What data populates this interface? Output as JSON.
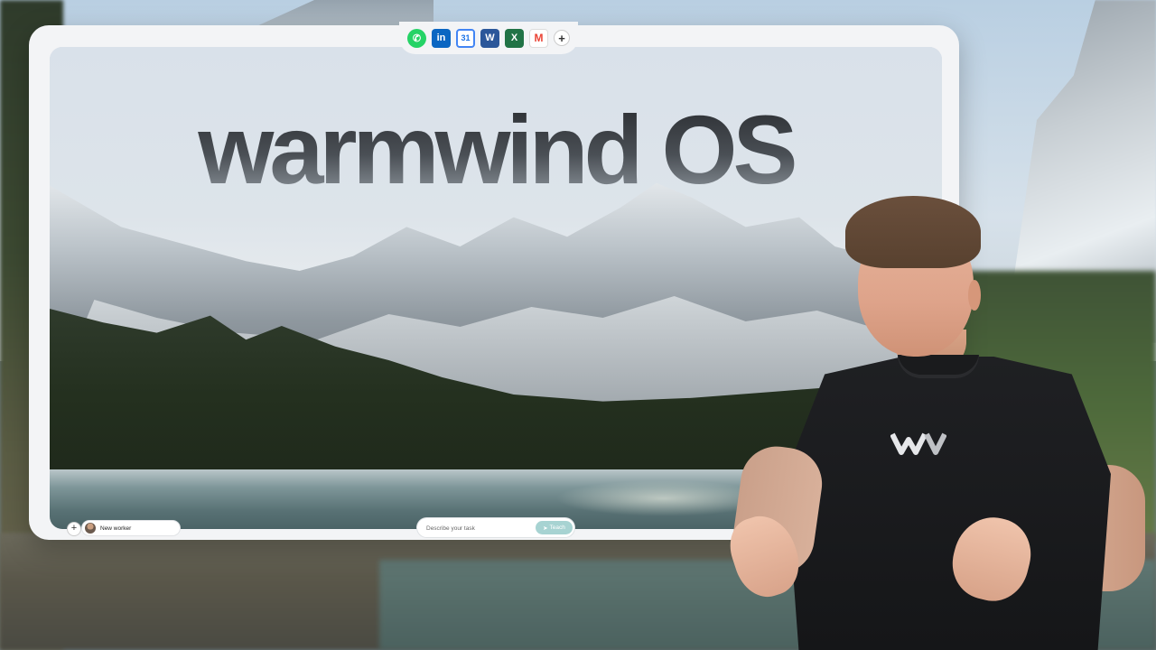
{
  "title": "warmwind OS",
  "dock": {
    "apps": [
      {
        "name": "whatsapp",
        "icon": "whatsapp-icon",
        "glyph": "✆"
      },
      {
        "name": "linkedin",
        "icon": "linkedin-icon",
        "glyph": "in"
      },
      {
        "name": "google-calendar",
        "icon": "calendar-icon",
        "glyph": "31"
      },
      {
        "name": "word",
        "icon": "word-icon",
        "glyph": "W"
      },
      {
        "name": "excel",
        "icon": "excel-icon",
        "glyph": "X"
      },
      {
        "name": "gmail",
        "icon": "gmail-icon",
        "glyph": "M"
      }
    ],
    "add_glyph": "+"
  },
  "bottom_bar": {
    "add_worker_glyph": "+",
    "worker_label": "New worker",
    "task_placeholder": "Describe your task",
    "teach_icon": "➤",
    "teach_label": "Teach"
  },
  "colors": {
    "teach_button": "#a7d3d2",
    "whatsapp": "#25d366",
    "linkedin": "#0a66c2",
    "word": "#2b579a",
    "excel": "#217346"
  }
}
